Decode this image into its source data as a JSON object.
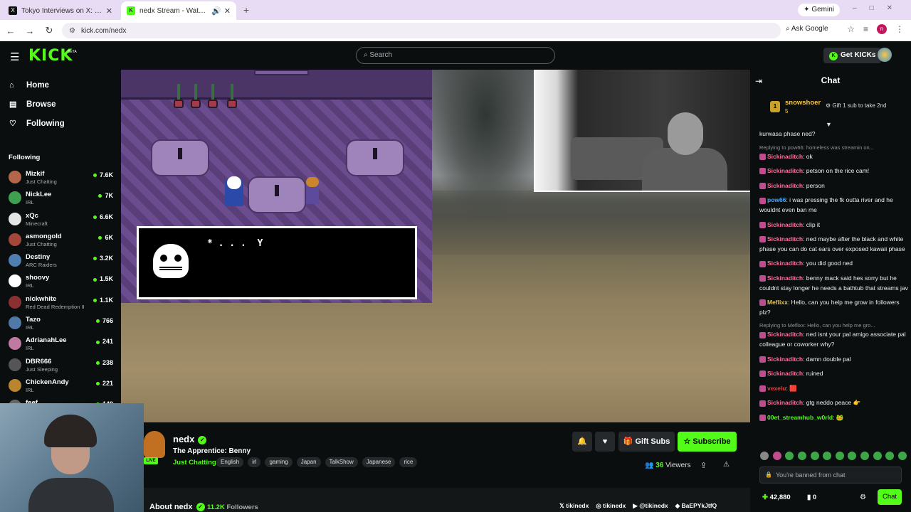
{
  "browser": {
    "tabs": [
      {
        "title": "Tokyo Interviews on X: \"@callit",
        "favicon": "X",
        "active": false
      },
      {
        "title": "nedx Stream - Watch Live o",
        "favicon": "K",
        "active": true
      }
    ],
    "url": "kick.com/nedx",
    "ask_google": "Ask Google",
    "gemini": "Gemini",
    "profile_initial": "n"
  },
  "header": {
    "logo": "KICK",
    "beta": "BETA",
    "search_placeholder": "Search",
    "get_kicks": "Get KICKs"
  },
  "sidebar": {
    "nav": [
      {
        "label": "Home",
        "icon": "home-icon"
      },
      {
        "label": "Browse",
        "icon": "browse-icon"
      },
      {
        "label": "Following",
        "icon": "heart-icon"
      }
    ],
    "section_title": "Following",
    "following": [
      {
        "name": "Mizkif",
        "category": "Just Chatting",
        "viewers": "7.6K",
        "color": "#b5654a"
      },
      {
        "name": "NickLee",
        "category": "IRL",
        "viewers": "7K",
        "color": "#3fa04f"
      },
      {
        "name": "xQc",
        "category": "Minecraft",
        "viewers": "6.6K",
        "color": "#e5e5e5"
      },
      {
        "name": "asmongold",
        "category": "Just Chatting",
        "viewers": "6K",
        "color": "#a3473b"
      },
      {
        "name": "Destiny",
        "category": "ARC Raiders",
        "viewers": "3.2K",
        "color": "#4f7fb0"
      },
      {
        "name": "shoovy",
        "category": "IRL",
        "viewers": "1.5K",
        "color": "#ffffff"
      },
      {
        "name": "nickwhite",
        "category": "Red Dead Redemption II",
        "viewers": "1.1K",
        "color": "#8a3030"
      },
      {
        "name": "Tazo",
        "category": "IRL",
        "viewers": "766",
        "color": "#5079a8"
      },
      {
        "name": "AdrianahLee",
        "category": "IRL",
        "viewers": "241",
        "color": "#c07aa0"
      },
      {
        "name": "DBR666",
        "category": "Just Sleeping",
        "viewers": "238",
        "color": "#555555"
      },
      {
        "name": "ChickenAndy",
        "category": "IRL",
        "viewers": "221",
        "color": "#b9862f"
      },
      {
        "name": "feef",
        "category": "",
        "viewers": "149",
        "color": "#666666"
      }
    ]
  },
  "game": {
    "dialog_text": "* . . .  Y"
  },
  "stream": {
    "channel": "nedx",
    "live_badge": "LIVE",
    "title": "The Apprentice: Benny",
    "category": "Just Chatting",
    "tags": [
      "English",
      "irl",
      "gaming",
      "Japan",
      "TalkShow",
      "Japanese",
      "rice"
    ],
    "gift_subs": "Gift Subs",
    "subscribe": "Subscribe",
    "viewers_count": "36",
    "viewers_label": "Viewers",
    "about": "About nedx",
    "followers_count": "11.2K",
    "followers_label": "Followers",
    "socials": [
      {
        "icon": "x-icon",
        "glyph": "𝕏",
        "handle": "tikinedx"
      },
      {
        "icon": "instagram-icon",
        "glyph": "◎",
        "handle": "tikinedx"
      },
      {
        "icon": "youtube-icon",
        "glyph": "▶",
        "handle": "@tikinedx"
      },
      {
        "icon": "discord-icon",
        "glyph": "◆",
        "handle": "BaEPYkJtfQ"
      }
    ]
  },
  "chat": {
    "title": "Chat",
    "pinned": {
      "rank": "1",
      "user": "snowshoer",
      "subs": "5",
      "gift_text": "Gift 1 sub to take 2nd"
    },
    "messages": [
      {
        "reply": "",
        "user": "",
        "user_color": "#ffffff",
        "text": "kurwasa phase ned?"
      },
      {
        "reply": "Replying to pow66: homeless was streamin on...",
        "user": "Sickinaditch",
        "user_color": "#ff6b9a",
        "text": ": ok"
      },
      {
        "reply": "",
        "user": "Sickinaditch",
        "user_color": "#ff6b9a",
        "text": ": petson on the rice cam!"
      },
      {
        "reply": "",
        "user": "Sickinaditch",
        "user_color": "#ff6b9a",
        "text": ": person"
      },
      {
        "reply": "",
        "user": "pow66",
        "user_color": "#4aa8ff",
        "text": ": i was pressing the fk outta river and he wouldnt even ban me"
      },
      {
        "reply": "",
        "user": "Sickinaditch",
        "user_color": "#ff6b9a",
        "text": ": clip it"
      },
      {
        "reply": "",
        "user": "Sickinaditch",
        "user_color": "#ff6b9a",
        "text": ": ned maybe after the black and white phase you can do cat ears over exposed kawaii phase"
      },
      {
        "reply": "",
        "user": "Sickinaditch",
        "user_color": "#ff6b9a",
        "text": ": you did good ned"
      },
      {
        "reply": "",
        "user": "Sickinaditch",
        "user_color": "#ff6b9a",
        "text": ": benny mack said hes sorry but he couldnt stay longer he needs a bathtub that streams jav"
      },
      {
        "reply": "",
        "user": "Meflixx",
        "user_color": "#e5c85a",
        "text": ": Hello, can you help me grow in followers plz?"
      },
      {
        "reply": "Replying to Meflixx: Hello, can you help me gro...",
        "user": "Sickinaditch",
        "user_color": "#ff6b9a",
        "text": ": ned isnt your pal amigo associate pal colleague or coworker why?"
      },
      {
        "reply": "",
        "user": "Sickinaditch",
        "user_color": "#ff6b9a",
        "text": ": damn double pal"
      },
      {
        "reply": "",
        "user": "Sickinaditch",
        "user_color": "#ff6b9a",
        "text": ": ruined"
      },
      {
        "reply": "",
        "user": "vexelu",
        "user_color": "#e04040",
        "text": ": 🟥"
      },
      {
        "reply": "",
        "user": "Sickinaditch",
        "user_color": "#ff6b9a",
        "text": ": gtg neddo peace 👉"
      },
      {
        "reply": "",
        "user": "00et_streamhub_w0rld",
        "user_color": "#53fc18",
        "text": ": 🐸"
      }
    ],
    "banned_text": "You're banned from chat",
    "points": "42,880",
    "subs_count": "0",
    "chat_button": "Chat"
  }
}
